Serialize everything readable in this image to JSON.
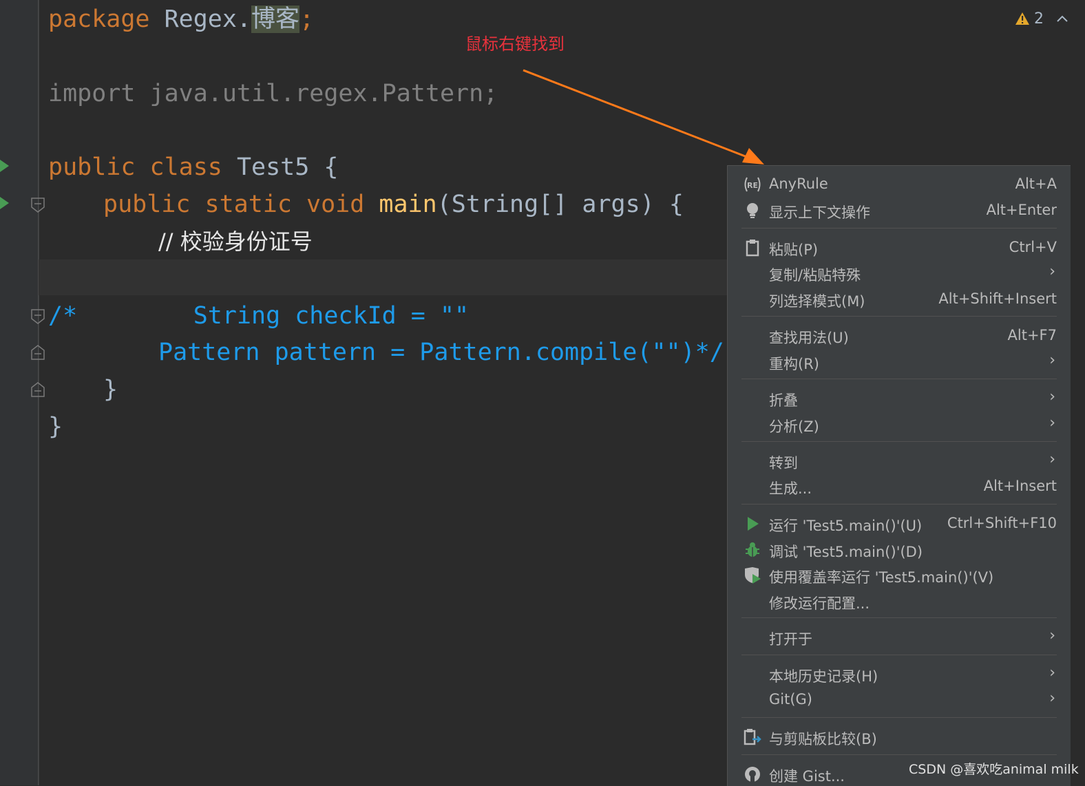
{
  "editor": {
    "lines": {
      "l1_kw": "package ",
      "l1_pkg": "Regex.",
      "l1_sel": "博客",
      "l1_semi": ";",
      "l2_import": "import java.util.regex.Pattern;",
      "l3_kw": "public class ",
      "l3_name": "Test5 {",
      "l4_kw": "public static void ",
      "l4_fn": "main",
      "l4_rest": "(String[] args) {",
      "l5_comment": "// 校验身份证号",
      "l6_block": "/*        String checkId = \"\"",
      "l7_block": "Pattern pattern = Pattern.compile(\"\")*/",
      "l8_close": "}",
      "l9_close": "}"
    }
  },
  "inspection": {
    "warning_count": "2",
    "colors": {
      "warning": "#e5a82c"
    }
  },
  "annotation": {
    "text": "鼠标右键找到",
    "color": "#e8323c",
    "arrow_color": "#ff7a1a"
  },
  "context_menu": {
    "items": [
      {
        "icon": "regex-icon",
        "label": "AnyRule",
        "shortcut": "Alt+A"
      },
      {
        "icon": "bulb-icon",
        "label": "显示上下文操作",
        "shortcut": "Alt+Enter"
      },
      {
        "icon": "clipboard-icon",
        "label": "粘贴(P)",
        "shortcut": "Ctrl+V"
      },
      {
        "icon": "",
        "label": "复制/粘贴特殊",
        "submenu": true
      },
      {
        "icon": "",
        "label": "列选择模式(M)",
        "shortcut": "Alt+Shift+Insert"
      },
      {
        "icon": "",
        "label": "查找用法(U)",
        "shortcut": "Alt+F7"
      },
      {
        "icon": "",
        "label": "重构(R)",
        "submenu": true
      },
      {
        "icon": "",
        "label": "折叠",
        "submenu": true
      },
      {
        "icon": "",
        "label": "分析(Z)",
        "submenu": true
      },
      {
        "icon": "",
        "label": "转到",
        "submenu": true
      },
      {
        "icon": "",
        "label": "生成...",
        "shortcut": "Alt+Insert"
      },
      {
        "icon": "run-icon",
        "label": "运行 'Test5.main()'(U)",
        "shortcut": "Ctrl+Shift+F10"
      },
      {
        "icon": "debug-icon",
        "label": "调试 'Test5.main()'(D)"
      },
      {
        "icon": "coverage-icon",
        "label": "使用覆盖率运行 'Test5.main()'(V)"
      },
      {
        "icon": "",
        "label": "修改运行配置..."
      },
      {
        "icon": "",
        "label": "打开于",
        "submenu": true
      },
      {
        "icon": "",
        "label": "本地历史记录(H)",
        "submenu": true
      },
      {
        "icon": "",
        "label": "Git(G)",
        "submenu": true
      },
      {
        "icon": "compare-clipboard-icon",
        "label": "与剪贴板比较(B)"
      },
      {
        "icon": "github-icon",
        "label": "创建 Gist..."
      }
    ]
  },
  "watermark": "CSDN @喜欢吃animal milk"
}
